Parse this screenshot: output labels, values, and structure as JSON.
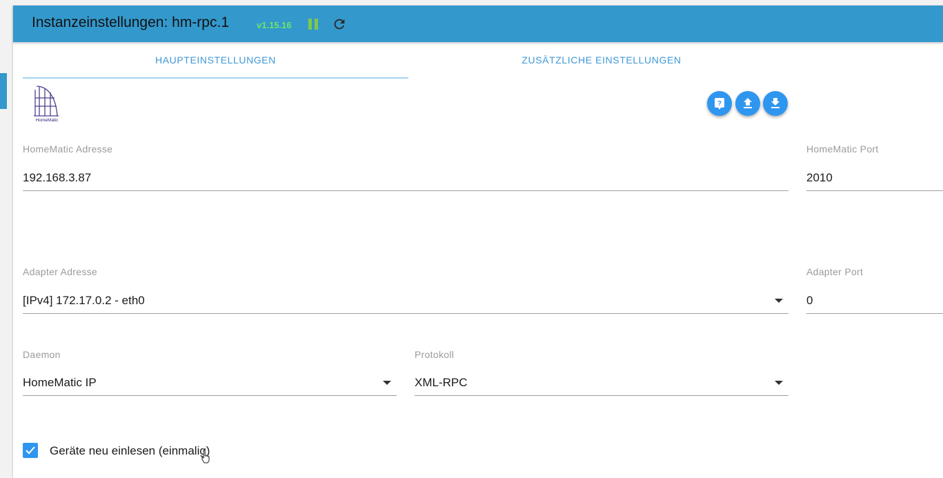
{
  "header": {
    "title": "Instanzeinstellungen: hm-rpc.1",
    "version": "v1.15.16",
    "pause_icon": "pause-icon",
    "refresh_icon": "refresh-icon",
    "color": "#3398cc"
  },
  "tabs": [
    {
      "label": "HAUPTEINSTELLUNGEN",
      "active": true
    },
    {
      "label": "ZUSÄTZLICHE EINSTELLUNGEN",
      "active": false
    }
  ],
  "actions": {
    "help_icon": "help-icon",
    "upload_icon": "upload-icon",
    "download_icon": "download-icon"
  },
  "logo": {
    "icon": "homematic-logo",
    "text": "HomeMatic"
  },
  "fields": {
    "homematic_address": {
      "label": "HomeMatic Adresse",
      "value": "192.168.3.87"
    },
    "homematic_port": {
      "label": "HomeMatic Port",
      "value": "2010"
    },
    "adapter_address": {
      "label": "Adapter Adresse",
      "value": "[IPv4] 172.17.0.2 - eth0"
    },
    "adapter_port": {
      "label": "Adapter Port",
      "value": "0"
    },
    "daemon": {
      "label": "Daemon",
      "value": "HomeMatic IP"
    },
    "protocol": {
      "label": "Protokoll",
      "value": "XML-RPC"
    }
  },
  "reread_devices": {
    "label": "Geräte neu einlesen (einmalig)",
    "checked": true
  },
  "colors": {
    "accent": "#2f96f0",
    "tab_text": "#3f98d6",
    "version": "#6ee36e"
  }
}
